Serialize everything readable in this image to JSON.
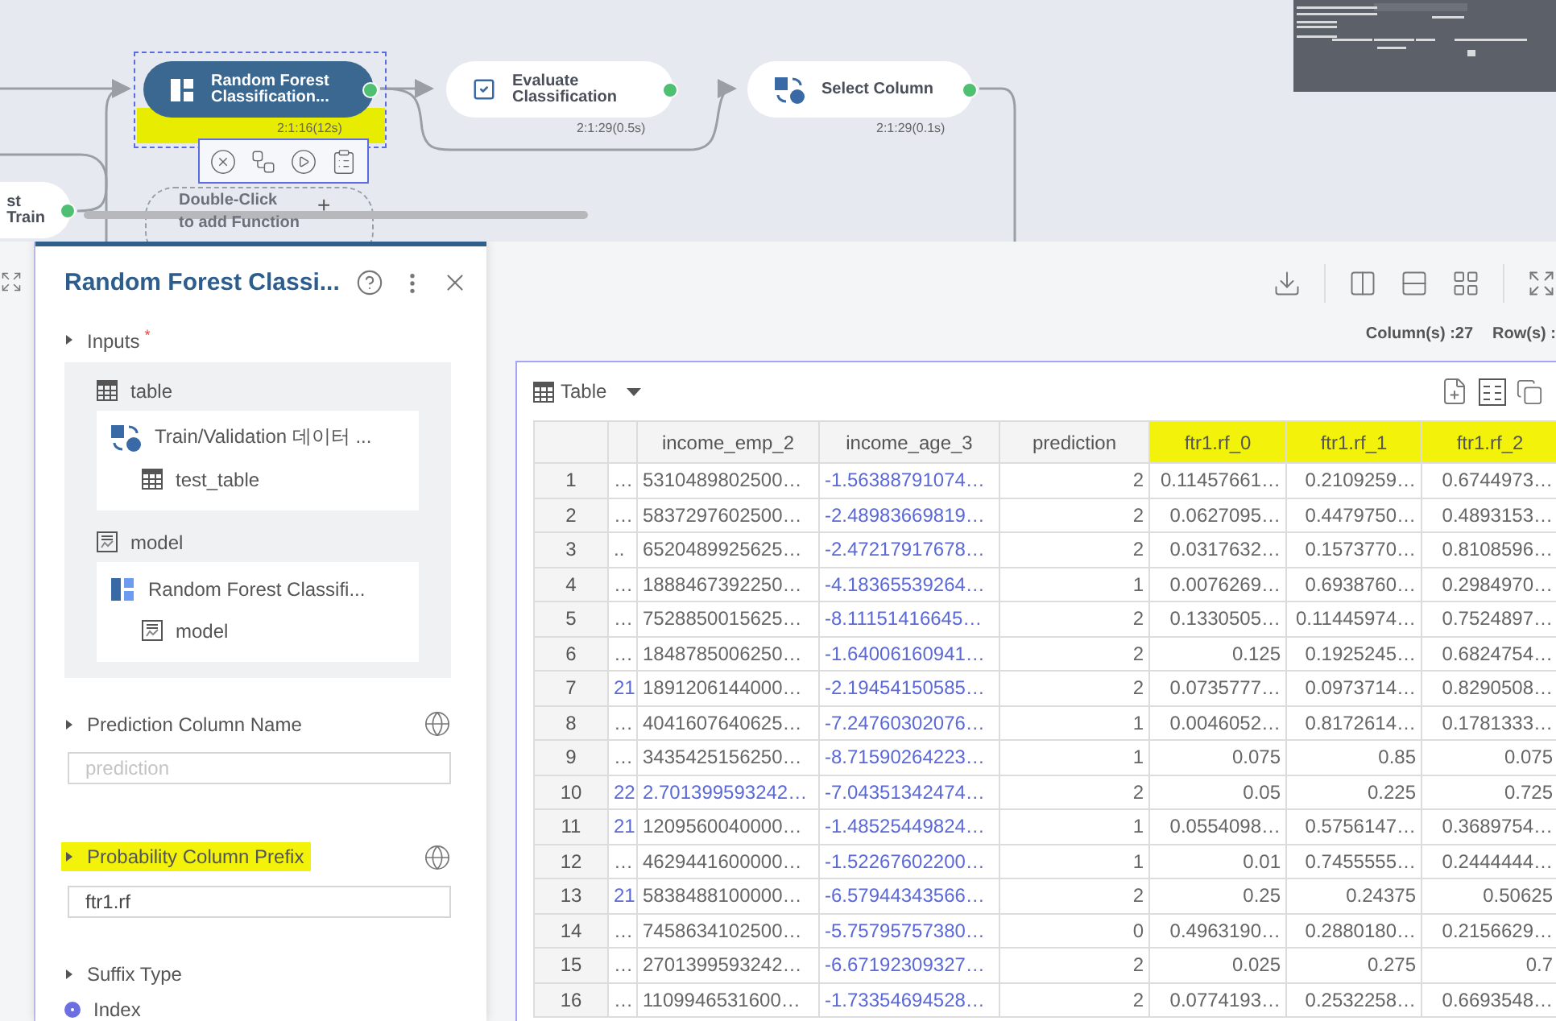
{
  "canvas": {
    "nodes": [
      {
        "kind": "partial",
        "lines": [
          "st",
          "Train"
        ],
        "selected": false
      },
      {
        "kind": "function",
        "lines": [
          "Random Forest",
          "Classification..."
        ],
        "selected": true,
        "timing": "2:1:16(12s)",
        "highlighted": true
      },
      {
        "kind": "function",
        "lines": [
          "Evaluate",
          "Classification"
        ],
        "selected": false,
        "timing": "2:1:29(0.5s)",
        "highlighted": false
      },
      {
        "kind": "function",
        "lines": [
          "Select Column"
        ],
        "selected": false,
        "timing": "2:1:29(0.1s)",
        "highlighted": false
      }
    ],
    "placeholder": {
      "lines": [
        "Double-Click",
        "to add Function"
      ],
      "symbol": "+"
    }
  },
  "panel": {
    "title": "Random Forest Classi...",
    "inputs": {
      "label": "Inputs",
      "required_mark": "*",
      "ports": [
        {
          "kind": "table",
          "name": "table",
          "source": "Train/Validation 데이터 ...",
          "output": "test_table"
        },
        {
          "kind": "model",
          "name": "model",
          "source": "Random Forest Classifi...",
          "output": "model"
        }
      ]
    },
    "params": [
      {
        "kind": "text",
        "label": "Prediction Column Name",
        "placeholder": "prediction",
        "highlighted": false
      },
      {
        "kind": "text",
        "label": "Probability Column Prefix",
        "value": "ftr1.rf",
        "highlighted": true
      },
      {
        "kind": "radio",
        "label": "Suffix Type",
        "highlighted": false,
        "options": [
          {
            "label": "Index",
            "selected": true
          }
        ]
      }
    ]
  },
  "results": {
    "summary": [
      "Column(s) :27",
      "Row(s) :"
    ],
    "table": {
      "view": "Table",
      "columns": [
        {
          "highlighted": false
        },
        {
          "label": "income_emp_2",
          "highlighted": false
        },
        {
          "label": "income_age_3",
          "highlighted": false
        },
        {
          "label": "prediction",
          "highlighted": false
        },
        {
          "label": "ftr1.rf_0",
          "highlighted": true
        },
        {
          "label": "ftr1.rf_1",
          "highlighted": true
        },
        {
          "label": "ftr1.rf_2",
          "highlighted": true
        }
      ],
      "rows": [
        {
          "index": "1",
          "linked": [
            false,
            false,
            true,
            false,
            false,
            false,
            false
          ],
          "cells": [
            "…",
            "5310489802500…",
            "-1.56388791074…",
            "2",
            "0.11457661…",
            "0.2109259…",
            "0.6744973…"
          ]
        },
        {
          "index": "2",
          "linked": [
            false,
            false,
            true,
            false,
            false,
            false,
            false
          ],
          "cells": [
            "…",
            "5837297602500…",
            "-2.48983669819…",
            "2",
            "0.0627095…",
            "0.4479750…",
            "0.4893153…"
          ]
        },
        {
          "index": "3",
          "linked": [
            false,
            false,
            true,
            false,
            false,
            false,
            false
          ],
          "cells": [
            "..",
            "6520489925625…",
            "-2.47217917678…",
            "2",
            "0.0317632…",
            "0.1573770…",
            "0.8108596…"
          ]
        },
        {
          "index": "4",
          "linked": [
            false,
            false,
            true,
            false,
            false,
            false,
            false
          ],
          "cells": [
            "…",
            "1888467392250…",
            "-4.18365539264…",
            "1",
            "0.0076269…",
            "0.6938760…",
            "0.2984970…"
          ]
        },
        {
          "index": "5",
          "linked": [
            false,
            false,
            true,
            false,
            false,
            false,
            false
          ],
          "cells": [
            "…",
            "7528850015625…",
            "-8.11151416645…",
            "2",
            "0.1330505…",
            "0.11445974…",
            "0.7524897…"
          ]
        },
        {
          "index": "6",
          "linked": [
            false,
            false,
            true,
            false,
            false,
            false,
            false
          ],
          "cells": [
            "…",
            "1848785006250…",
            "-1.64006160941…",
            "2",
            "0.125",
            "0.1925245…",
            "0.6824754…"
          ]
        },
        {
          "index": "7",
          "linked": [
            true,
            false,
            true,
            false,
            false,
            false,
            false
          ],
          "cells": [
            "21",
            "1891206144000…",
            "-2.19454150585…",
            "2",
            "0.0735777…",
            "0.0973714…",
            "0.8290508…"
          ]
        },
        {
          "index": "8",
          "linked": [
            false,
            false,
            true,
            false,
            false,
            false,
            false
          ],
          "cells": [
            "…",
            "4041607640625…",
            "-7.24760302076…",
            "1",
            "0.0046052…",
            "0.8172614…",
            "0.1781333…"
          ]
        },
        {
          "index": "9",
          "linked": [
            false,
            false,
            true,
            false,
            false,
            false,
            false
          ],
          "cells": [
            "…",
            "3435425156250…",
            "-8.71590264223…",
            "1",
            "0.075",
            "0.85",
            "0.075"
          ]
        },
        {
          "index": "10",
          "linked": [
            true,
            true,
            true,
            false,
            false,
            false,
            false
          ],
          "cells": [
            "22",
            "2.701399593242…",
            "-7.04351342474…",
            "2",
            "0.05",
            "0.225",
            "0.725"
          ]
        },
        {
          "index": "11",
          "linked": [
            true,
            false,
            true,
            false,
            false,
            false,
            false
          ],
          "cells": [
            "21",
            "1209560040000…",
            "-1.48525449824…",
            "1",
            "0.0554098…",
            "0.5756147…",
            "0.3689754…"
          ]
        },
        {
          "index": "12",
          "linked": [
            false,
            false,
            true,
            false,
            false,
            false,
            false
          ],
          "cells": [
            "…",
            "4629441600000…",
            "-1.52267602200…",
            "1",
            "0.01",
            "0.7455555…",
            "0.2444444…"
          ]
        },
        {
          "index": "13",
          "linked": [
            true,
            false,
            true,
            false,
            false,
            false,
            false
          ],
          "cells": [
            "21",
            "5838488100000…",
            "-6.57944343566…",
            "2",
            "0.25",
            "0.24375",
            "0.50625"
          ]
        },
        {
          "index": "14",
          "linked": [
            false,
            false,
            true,
            false,
            false,
            false,
            false
          ],
          "cells": [
            "…",
            "7458634102500…",
            "-5.75795757380…",
            "0",
            "0.4963190…",
            "0.2880180…",
            "0.2156629…"
          ]
        },
        {
          "index": "15",
          "linked": [
            false,
            false,
            true,
            false,
            false,
            false,
            false
          ],
          "cells": [
            "…",
            "2701399593242…",
            "-6.67192309327…",
            "2",
            "0.025",
            "0.275",
            "0.7"
          ]
        },
        {
          "index": "16",
          "linked": [
            false,
            false,
            true,
            false,
            false,
            false,
            false
          ],
          "cells": [
            "…",
            "1109946531600…",
            "-1.73354694528…",
            "2",
            "0.0774193…",
            "0.2532258…",
            "0.6693548…"
          ]
        }
      ]
    }
  }
}
